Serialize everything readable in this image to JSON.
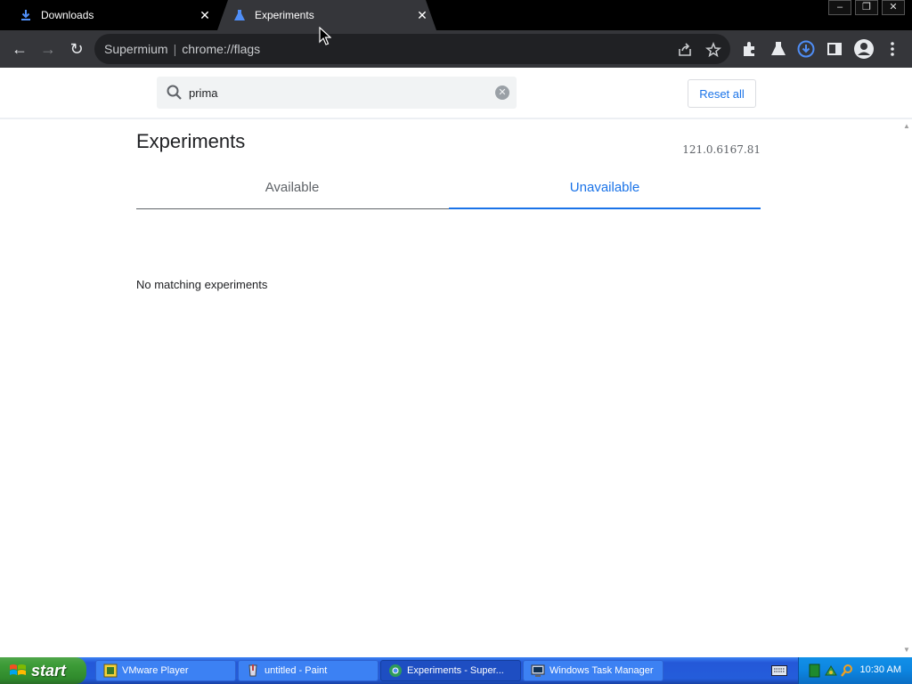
{
  "tabs": [
    {
      "title": "Downloads",
      "icon": "download-icon",
      "active": false
    },
    {
      "title": "Experiments",
      "icon": "flask-icon",
      "active": true
    }
  ],
  "window_controls": {
    "minimize": "–",
    "restore": "❐",
    "close": "✕"
  },
  "toolbar": {
    "back": "←",
    "forward": "→",
    "reload": "↻",
    "omnibox": {
      "site": "Supermium",
      "separator": "|",
      "url": "chrome://flags"
    }
  },
  "page": {
    "search": {
      "value": "prima",
      "placeholder": "Search flags"
    },
    "reset_all_label": "Reset all",
    "title": "Experiments",
    "version": "121.0.6167.81",
    "tabs": [
      {
        "label": "Available",
        "selected": false
      },
      {
        "label": "Unavailable",
        "selected": true
      }
    ],
    "empty_message": "No matching experiments"
  },
  "taskbar": {
    "start_label": "start",
    "tasks": [
      {
        "label": "VMware Player",
        "icon": "vmware-icon",
        "active": false
      },
      {
        "label": "untitled - Paint",
        "icon": "paint-icon",
        "active": false
      },
      {
        "label": "Experiments - Super...",
        "icon": "browser-icon",
        "active": true
      },
      {
        "label": "Windows Task Manager",
        "icon": "task-manager-icon",
        "active": false
      }
    ],
    "clock": "10:30 AM"
  },
  "colors": {
    "accent": "#1a73e8",
    "toolbar": "#35363a",
    "tabstrip": "#000000",
    "taskbar": "#245ddb",
    "start_green": "#3c9b37"
  }
}
